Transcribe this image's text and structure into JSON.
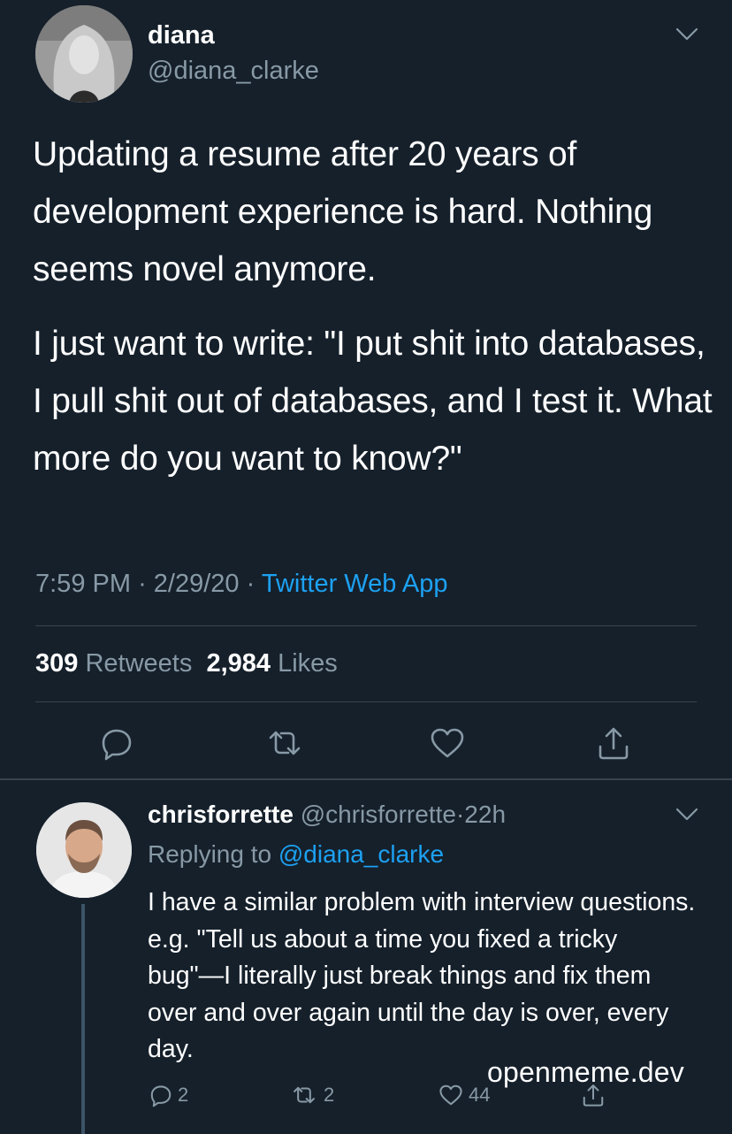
{
  "main_tweet": {
    "display_name": "diana",
    "handle": "@diana_clarke",
    "paragraphs": [
      "Updating a resume after 20 years of development experience is hard. Nothing seems novel anymore.",
      "I just want to write: \"I put shit into databases, I pull shit out of databases, and I test it. What more do you want to know?\""
    ],
    "time": "7:59 PM",
    "date": "2/29/20",
    "separator": "·",
    "source": "Twitter Web App",
    "retweets_count": "309",
    "retweets_label": "Retweets",
    "likes_count": "2,984",
    "likes_label": "Likes",
    "icons": {
      "reply": "reply-icon",
      "retweet": "retweet-icon",
      "like": "heart-icon",
      "share": "share-icon",
      "more": "chevron-down-icon"
    }
  },
  "reply_tweet": {
    "display_name": "chrisforrette",
    "handle": "@chrisforrette",
    "separator": "·",
    "time": "22h",
    "replying_to_label": "Replying to",
    "replying_to_handle": "@diana_clarke",
    "text": "I have a similar problem with interview questions. e.g. \"Tell us about a time you fixed a tricky bug\"—I literally just break things and fix them over and over again until the day is over, every day.",
    "reply_count": "2",
    "retweet_count": "2",
    "like_count": "44"
  },
  "watermark": "openmeme.dev",
  "colors": {
    "background": "#15202b",
    "text": "#ffffff",
    "secondary": "#8899a6",
    "link": "#1da1f2",
    "divider": "#38444d"
  }
}
